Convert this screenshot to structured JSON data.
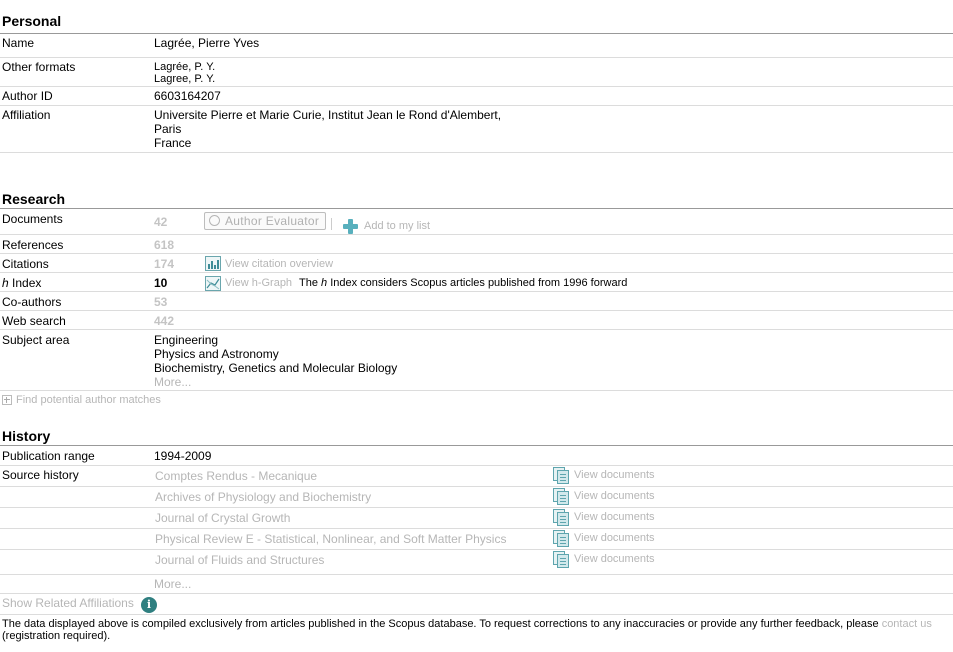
{
  "personal": {
    "title": "Personal",
    "name_label": "Name",
    "name_value": "Lagrée, Pierre Yves",
    "other_formats_label": "Other formats",
    "other_formats": [
      "Lagrée, P. Y.",
      "Lagree, P. Y."
    ],
    "author_id_label": "Author ID",
    "author_id_value": "6603164207",
    "affiliation_label": "Affiliation",
    "affiliation_lines": [
      "Universite Pierre et Marie Curie, Institut Jean le Rond d'Alembert,",
      "Paris",
      "France"
    ]
  },
  "research": {
    "title": "Research",
    "documents_label": "Documents",
    "documents_value": "42",
    "author_evaluator_label": "Author Evaluator",
    "add_to_list_label": "Add to my list",
    "references_label": "References",
    "references_value": "618",
    "citations_label": "Citations",
    "citations_value": "174",
    "view_citation_overview": "View citation overview",
    "h_index_label_italic": "h",
    "h_index_label_rest": " Index",
    "h_index_value": "10",
    "view_h_graph": "View h-Graph",
    "h_note_pre": "The ",
    "h_note_italic": "h",
    "h_note_post": " Index considers Scopus articles published from 1996 forward",
    "coauthors_label": "Co-authors",
    "coauthors_value": "53",
    "web_search_label": "Web search",
    "web_search_value": "442",
    "subject_area_label": "Subject area",
    "subject_areas": [
      "Engineering",
      "Physics and Astronomy",
      "Biochemistry, Genetics and Molecular Biology"
    ],
    "subject_more": "More...",
    "find_matches": "Find potential author matches"
  },
  "history": {
    "title": "History",
    "pub_range_label": "Publication range",
    "pub_range_value": "1994-2009",
    "source_history_label": "Source history",
    "sources": [
      {
        "name": "Comptes Rendus - Mecanique",
        "action": "View documents"
      },
      {
        "name": "Archives of Physiology and Biochemistry",
        "action": "View documents"
      },
      {
        "name": "Journal of Crystal Growth",
        "action": "View documents"
      },
      {
        "name": "Physical Review E - Statistical, Nonlinear, and Soft Matter Physics",
        "action": "View documents"
      },
      {
        "name": "Journal of Fluids and Structures",
        "action": "View documents"
      }
    ],
    "sources_more": "More..."
  },
  "related": {
    "show_related": "Show Related Affiliations"
  },
  "footer": {
    "text": "The data displayed above is compiled exclusively from articles published in the Scopus database. To request corrections to any inaccuracies or provide any further feedback, please ",
    "contact_link": "contact us",
    "text_end": "(registration required)."
  }
}
